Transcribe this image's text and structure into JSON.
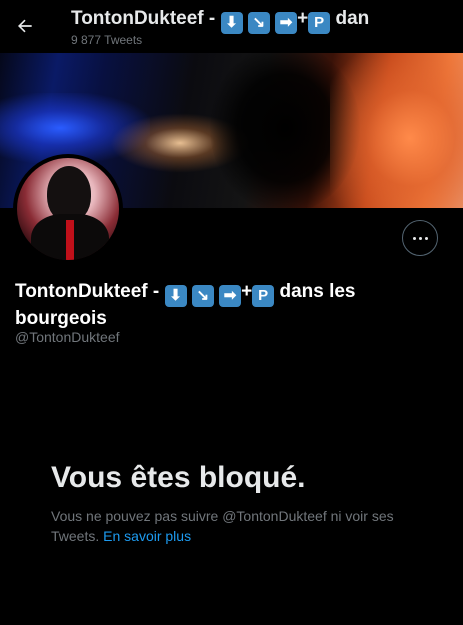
{
  "header": {
    "name_prefix": "TontonDukteef - ",
    "name_suffix": " dan",
    "tweet_count": "9 877 Tweets"
  },
  "name_keys": {
    "down": "⬇",
    "down_right": "↘",
    "right": "➡",
    "plus": "+",
    "p": "P"
  },
  "profile": {
    "name_prefix": "TontonDukteef - ",
    "name_suffix": " dans les bourgeois",
    "handle": "@TontonDukteef"
  },
  "blocked": {
    "title": "Vous êtes bloqué.",
    "message": "Vous ne pouvez pas suivre @TontonDukteef ni voir ses Tweets. ",
    "link": "En savoir plus"
  },
  "icons": {
    "back": "arrow-left-icon",
    "more": "more-horizontal-icon"
  },
  "colors": {
    "background": "#000000",
    "primary_text": "#e7e9ea",
    "secondary_text": "#71767b",
    "link": "#1d9bf0",
    "keycap": "#3b88c3"
  }
}
